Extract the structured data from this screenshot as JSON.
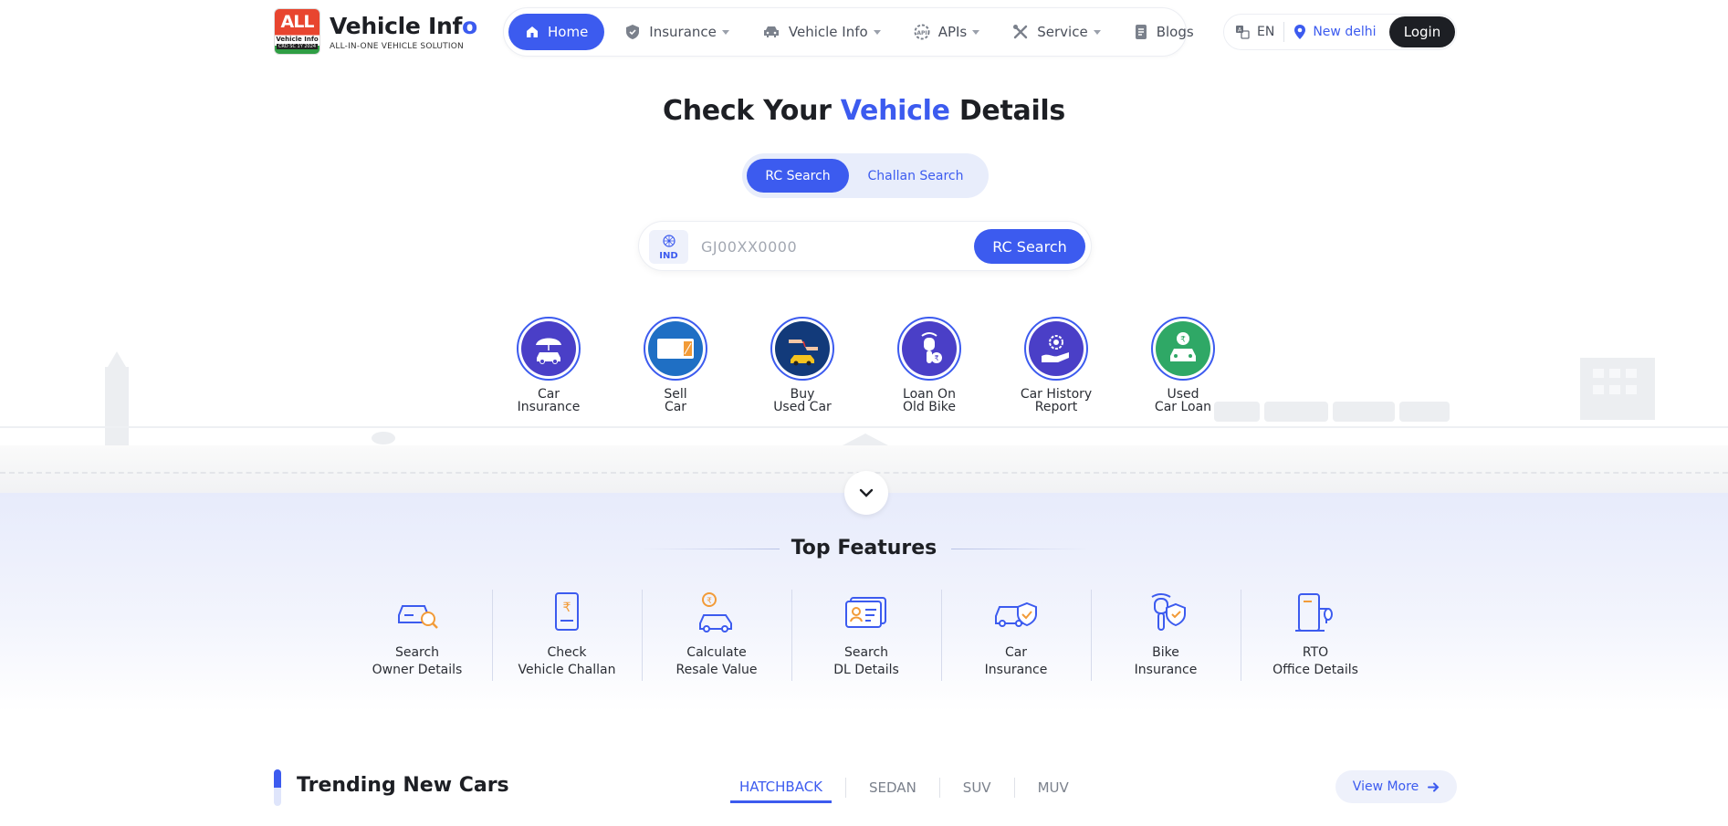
{
  "brand": {
    "badge_top": "ALL",
    "badge_mid": "Vehicle Info",
    "badge_bottom": "CRD SC 1Y 2024",
    "title_main": "Vehicle Inf",
    "title_end": "o",
    "tagline": "ALL-IN-ONE VEHICLE SOLUTION"
  },
  "nav": {
    "items": [
      {
        "label": "Home",
        "icon": "home-icon",
        "active": true
      },
      {
        "label": "Insurance",
        "icon": "shield-icon"
      },
      {
        "label": "Vehicle Info",
        "icon": "car-icon"
      },
      {
        "label": "APIs",
        "icon": "api-icon"
      },
      {
        "label": "Service",
        "icon": "tools-icon"
      },
      {
        "label": "Blogs",
        "icon": "document-icon"
      }
    ]
  },
  "util": {
    "language": "EN",
    "location": "New delhi",
    "login": "Login"
  },
  "hero": {
    "title_pre": "Check Your ",
    "title_accent": "Vehicle",
    "title_post": " Details",
    "tab_rc": "RC Search",
    "tab_challan": "Challan Search",
    "country": "IND",
    "placeholder": "GJ00XX0000",
    "search_button": "RC Search"
  },
  "quick_links": [
    {
      "line1": "Car",
      "line2": "Insurance",
      "bg": "#4a3fc7"
    },
    {
      "line1": "Sell",
      "line2": "Car",
      "bg": "#1f6fc4"
    },
    {
      "line1": "Buy",
      "line2": "Used Car",
      "bg": "#123a7a"
    },
    {
      "line1": "Loan On",
      "line2": "Old Bike",
      "bg": "#4a3fc7"
    },
    {
      "line1": "Car History",
      "line2": "Report",
      "bg": "#4a3fc7"
    },
    {
      "line1": "Used",
      "line2": "Car Loan",
      "bg": "#2fa866"
    }
  ],
  "features": {
    "title": "Top Features",
    "items": [
      {
        "line1": "Search",
        "line2": "Owner Details"
      },
      {
        "line1": "Check",
        "line2": "Vehicle Challan"
      },
      {
        "line1": "Calculate",
        "line2": "Resale Value"
      },
      {
        "line1": "Search",
        "line2": "DL Details"
      },
      {
        "line1": "Car",
        "line2": "Insurance"
      },
      {
        "line1": "Bike",
        "line2": "Insurance"
      },
      {
        "line1": "RTO",
        "line2": "Office Details"
      }
    ]
  },
  "trending": {
    "title": "Trending New Cars",
    "tabs": [
      "HATCHBACK",
      "SEDAN",
      "SUV",
      "MUV"
    ],
    "view_more": "View More"
  },
  "colors": {
    "accent": "#3c5bef",
    "dark": "#1d1f24",
    "feature_bg": "#e7ebfb"
  }
}
